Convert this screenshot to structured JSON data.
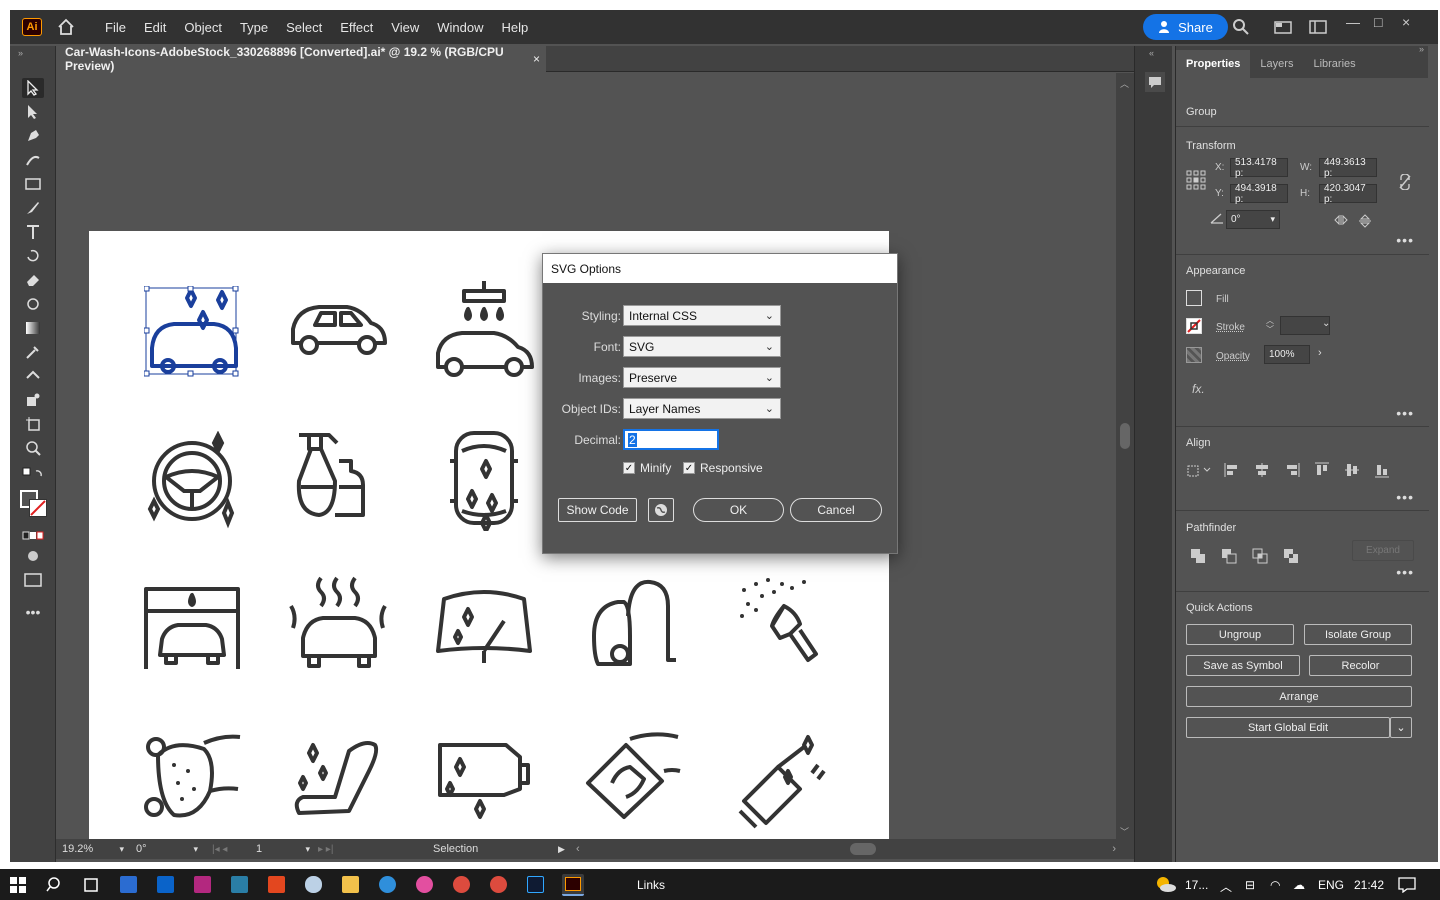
{
  "app": {
    "logo_text": "Ai",
    "menus": [
      "File",
      "Edit",
      "Object",
      "Type",
      "Select",
      "Effect",
      "View",
      "Window",
      "Help"
    ],
    "share_label": "Share",
    "document_tab": "Car-Wash-Icons-AdobeStock_330268896 [Converted].ai* @ 19.2 % (RGB/CPU Preview)",
    "close_glyph": "×"
  },
  "status": {
    "zoom": "19.2%",
    "rotation": "0°",
    "artboard": "1",
    "tool": "Selection"
  },
  "properties": {
    "tabs": [
      "Properties",
      "Layers",
      "Libraries"
    ],
    "selection_type": "Group",
    "transform": {
      "title": "Transform",
      "x_label": "X:",
      "x": "513.4178 p:",
      "y_label": "Y:",
      "y": "494.3918 p:",
      "w_label": "W:",
      "w": "449.3613 p:",
      "h_label": "H:",
      "h": "420.3047 p:",
      "angle": "0°"
    },
    "appearance": {
      "title": "Appearance",
      "fill": "Fill",
      "stroke": "Stroke",
      "opacity_label": "Opacity",
      "opacity": "100%",
      "fx": "fx."
    },
    "align_title": "Align",
    "pathfinder": {
      "title": "Pathfinder",
      "expand": "Expand"
    },
    "quick_actions": {
      "title": "Quick Actions",
      "ungroup": "Ungroup",
      "isolate": "Isolate Group",
      "save_symbol": "Save as Symbol",
      "recolor": "Recolor",
      "arrange": "Arrange",
      "global_edit": "Start Global Edit"
    }
  },
  "dialog": {
    "title": "SVG Options",
    "styling_label": "Styling:",
    "styling": "Internal CSS",
    "font_label": "Font:",
    "font": "SVG",
    "images_label": "Images:",
    "images": "Preserve",
    "ids_label": "Object IDs:",
    "ids": "Layer Names",
    "decimal_label": "Decimal:",
    "decimal": "2",
    "minify": "Minify",
    "minify_checked": true,
    "responsive": "Responsive",
    "responsive_checked": true,
    "show_code": "Show Code",
    "ok": "OK",
    "cancel": "Cancel"
  },
  "taskbar": {
    "running_label": "Links",
    "weather": "17...",
    "language": "ENG",
    "time": "21:42"
  },
  "colors": {
    "accent": "#1473e6",
    "selection": "#1a3f9c",
    "ui_dark": "#323232",
    "ui_mid": "#535353",
    "ai_orange": "#ff9a00"
  }
}
